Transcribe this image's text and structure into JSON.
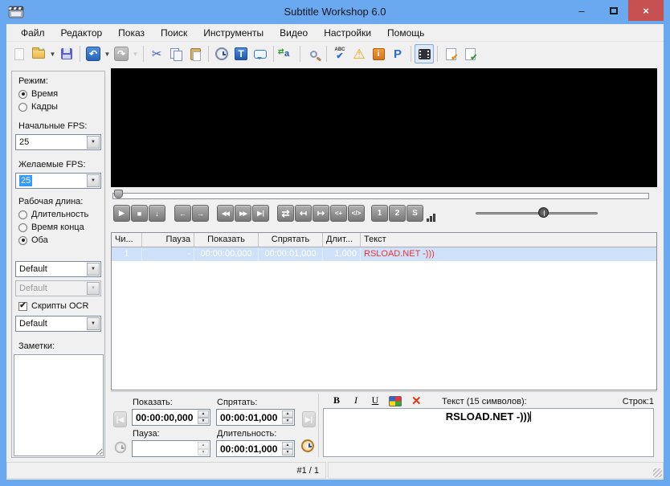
{
  "window": {
    "title": "Subtitle Workshop 6.0",
    "minimize": "–",
    "close": "×"
  },
  "menu": {
    "items": [
      "Файл",
      "Редактор",
      "Показ",
      "Поиск",
      "Инструменты",
      "Видео",
      "Настройки",
      "Помощь"
    ]
  },
  "toolbar": {
    "icon_names": [
      "new-file",
      "open-file",
      "save",
      "undo",
      "redo",
      "cut",
      "copy",
      "paste",
      "set-time",
      "set-text",
      "subtitle-note",
      "translate",
      "search",
      "spellcheck",
      "errors-warning",
      "information",
      "properties",
      "video-mode",
      "fix-errors",
      "check-ok"
    ]
  },
  "icons": {
    "undo": "↶",
    "redo": "↷",
    "cut": "✂",
    "warning": "⚠",
    "info": "i",
    "properties": "P",
    "set_text": "T",
    "translate": "a",
    "spell_abc": "ABC",
    "check": "✔",
    "caret": "▼",
    "play": "▶",
    "stop": "■",
    "jump": "↓",
    "prev": "←",
    "next": "→",
    "rewind": "◀◀",
    "forward": "▶▶",
    "step": "▶|",
    "loop": "⇄",
    "start_cursor": "↤",
    "end_cursor": "↦",
    "plus": "<+",
    "code": "</>",
    "one": "1",
    "two": "2",
    "s": "S",
    "prev_sub": "|◀",
    "next_sub": "▶|",
    "spin_up": "▲",
    "spin_down": "▼"
  },
  "sidebar": {
    "mode_label": "Режим:",
    "mode_time": "Время",
    "mode_frames": "Кадры",
    "input_fps_label": "Начальные FPS:",
    "input_fps_value": "25",
    "output_fps_label": "Желаемые FPS:",
    "output_fps_value": "25",
    "work_label": "Рабочая длина:",
    "work_duration": "Длительность",
    "work_endtime": "Время конца",
    "work_both": "Оба",
    "charset1": "Default",
    "charset2": "Default",
    "ocr_label": "Скрипты OCR",
    "ocr_script": "Default",
    "notes_label": "Заметки:"
  },
  "table": {
    "columns": [
      "Чи...",
      "Пауза",
      "Показать",
      "Спрятать",
      "Длит...",
      "Текст"
    ],
    "rows": [
      {
        "num": "1",
        "pause": "-",
        "show": "00:00:00,000",
        "hide": "00:00:01,000",
        "duration": "1,000",
        "text": "RSLOAD.NET -)))"
      }
    ]
  },
  "editor": {
    "show_label": "Показать:",
    "show_value": "00:00:00,000",
    "hide_label": "Спрятать:",
    "hide_value": "00:00:01,000",
    "pause_label": "Пауза:",
    "pause_value": "",
    "duration_label": "Длительность:",
    "duration_value": "00:00:01,000",
    "bold": "B",
    "italic": "I",
    "underline": "U",
    "text_label": "Текст (15 символов):",
    "lines_label": "Строк:1",
    "text_value": "RSLOAD.NET -)))"
  },
  "statusbar": {
    "position": "#1 / 1"
  }
}
